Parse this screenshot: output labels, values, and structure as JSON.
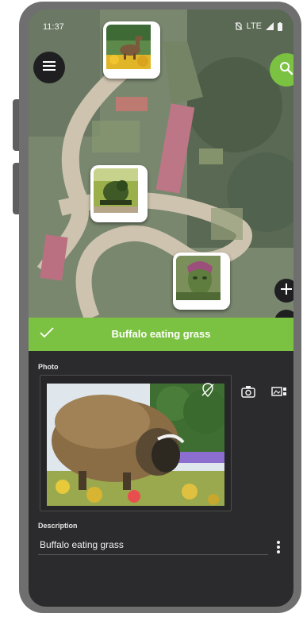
{
  "status_bar": {
    "time": "11:37",
    "network": "LTE"
  },
  "map": {
    "menu_icon": "hamburger-menu-icon",
    "search_icon": "search-icon",
    "zoom_in_icon": "plus-icon"
  },
  "title_bar": {
    "check_icon": "checkmark-icon",
    "title": "Buffalo eating grass"
  },
  "photo_section": {
    "label": "Photo",
    "location_off_icon": "location-off-icon",
    "camera_icon": "camera-icon",
    "gallery_icon": "gallery-icon"
  },
  "description_section": {
    "label": "Description",
    "value": "Buffalo eating grass",
    "more_icon": "more-vertical-icon"
  },
  "colors": {
    "accent": "#7cc242",
    "panel_bg": "#2b2b2d",
    "button_dark": "#1f1f21"
  }
}
